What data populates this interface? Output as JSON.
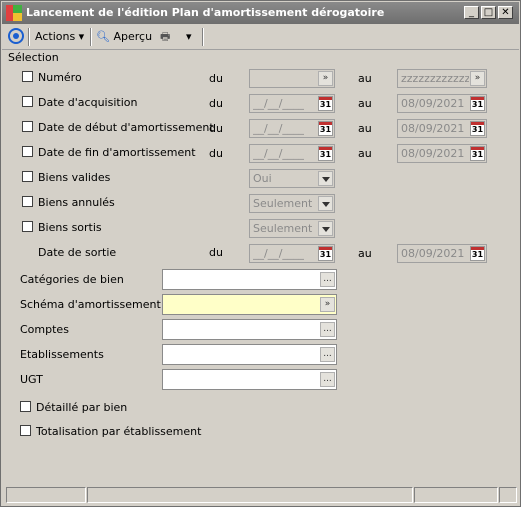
{
  "window": {
    "title": "Lancement de l'édition Plan d'amortissement dérogatoire"
  },
  "toolbar": {
    "actions_label": "Actions",
    "preview_label": "Aperçu"
  },
  "section": {
    "selection_label": "Sélection"
  },
  "labels": {
    "du": "du",
    "au": "au"
  },
  "fields": {
    "numero": {
      "label": "Numéro",
      "from": "",
      "to": "zzzzzzzzzzzz"
    },
    "date_acquisition": {
      "label": "Date d'acquisition",
      "from": "__/__/____",
      "to": "08/09/2021"
    },
    "date_debut_amort": {
      "label": "Date de début d'amortissement",
      "from": "__/__/____",
      "to": "08/09/2021"
    },
    "date_fin_amort": {
      "label": "Date de fin d'amortissement",
      "from": "__/__/____",
      "to": "08/09/2021"
    },
    "biens_valides": {
      "label": "Biens valides",
      "value": "Oui"
    },
    "biens_annules": {
      "label": "Biens annulés",
      "value": "Seulement"
    },
    "biens_sortis": {
      "label": "Biens sortis",
      "value": "Seulement"
    },
    "date_sortie": {
      "label": "Date de sortie",
      "from": "__/__/____",
      "to": "08/09/2021"
    },
    "categories_bien": {
      "label": "Catégories de bien",
      "value": ""
    },
    "schema_amort": {
      "label": "Schéma d'amortissement",
      "value": ""
    },
    "comptes": {
      "label": "Comptes",
      "value": ""
    },
    "etablissements": {
      "label": "Etablissements",
      "value": ""
    },
    "ugt": {
      "label": "UGT",
      "value": ""
    }
  },
  "options": {
    "detaille_par_bien": "Détaillé par bien",
    "totalisation_par_etablissement": "Totalisation par établissement"
  },
  "calendar_day": "31",
  "ellipsis": "..."
}
